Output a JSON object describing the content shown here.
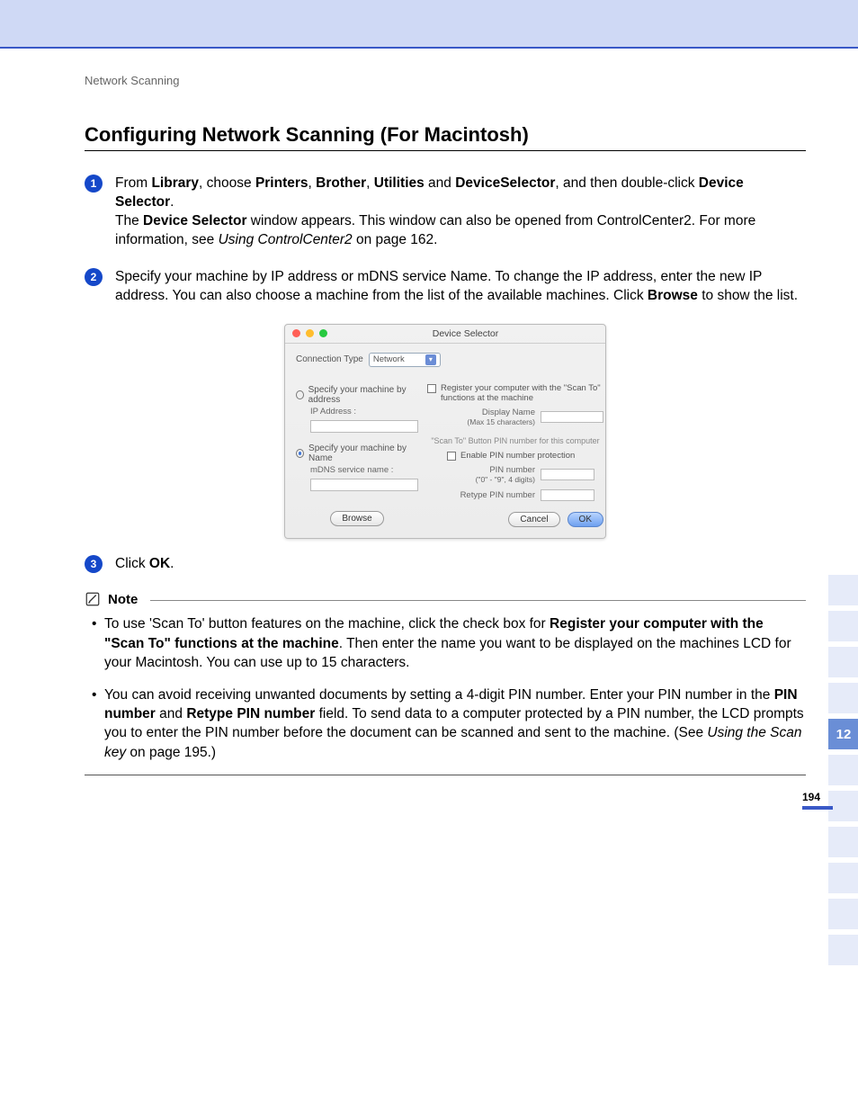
{
  "header": {
    "section": "Network Scanning"
  },
  "heading": "Configuring Network Scanning (For Macintosh)",
  "steps": [
    {
      "num": "1",
      "html": "From <b>Library</b>, choose <b>Printers</b>, <b>Brother</b>, <b>Utilities</b> and <b>DeviceSelector</b>, and then double-click <b>Device Selector</b>.<br>The <b>Device Selector</b> window appears. This window can also be opened from ControlCenter2. For more information, see <i>Using ControlCenter2</i> on page 162."
    },
    {
      "num": "2",
      "html": "Specify your machine by IP address or mDNS service Name. To change the IP address, enter the new IP address. You can also choose a machine from the list of the available machines. Click <b>Browse</b> to show the list."
    },
    {
      "num": "3",
      "html": "Click <b>OK</b>."
    }
  ],
  "dialog": {
    "title": "Device Selector",
    "connTypeLabel": "Connection Type",
    "connTypeValue": "Network",
    "radioByAddress": "Specify your machine by address",
    "ipAddressLabel": "IP Address :",
    "radioByName": "Specify your machine by Name",
    "mdnsLabel": "mDNS service name :",
    "browse": "Browse",
    "registerCheck": "Register your computer with the \"Scan To\" functions at the machine",
    "displayNameLabel": "Display Name",
    "displayNameHint": "(Max 15 characters)",
    "pinSectionHint": "\"Scan To\" Button PIN number for this computer",
    "enablePinLabel": "Enable PIN number protection",
    "pinLabel": "PIN number",
    "pinHint": "(\"0\" - \"9\",  4 digits)",
    "retypePinLabel": "Retype PIN number",
    "cancel": "Cancel",
    "ok": "OK"
  },
  "note": {
    "label": "Note",
    "bullets": [
      "To use 'Scan To' button features on the machine, click the check box for <b>Register your computer with the \"Scan To\"  functions at the machine</b>. Then enter the name you want to be displayed on the machines LCD for your Macintosh. You can use up to 15 characters.",
      "You can avoid receiving unwanted documents by setting a 4-digit PIN number. Enter your PIN number in the <b>PIN number</b> and <b>Retype PIN number</b> field. To send data to a computer protected by a PIN number, the LCD prompts you to enter the PIN number before the document can be scanned and sent to the machine. (See <i>Using the Scan key</i> on page 195.)"
    ]
  },
  "sideTab": "12",
  "pageNumber": "194"
}
